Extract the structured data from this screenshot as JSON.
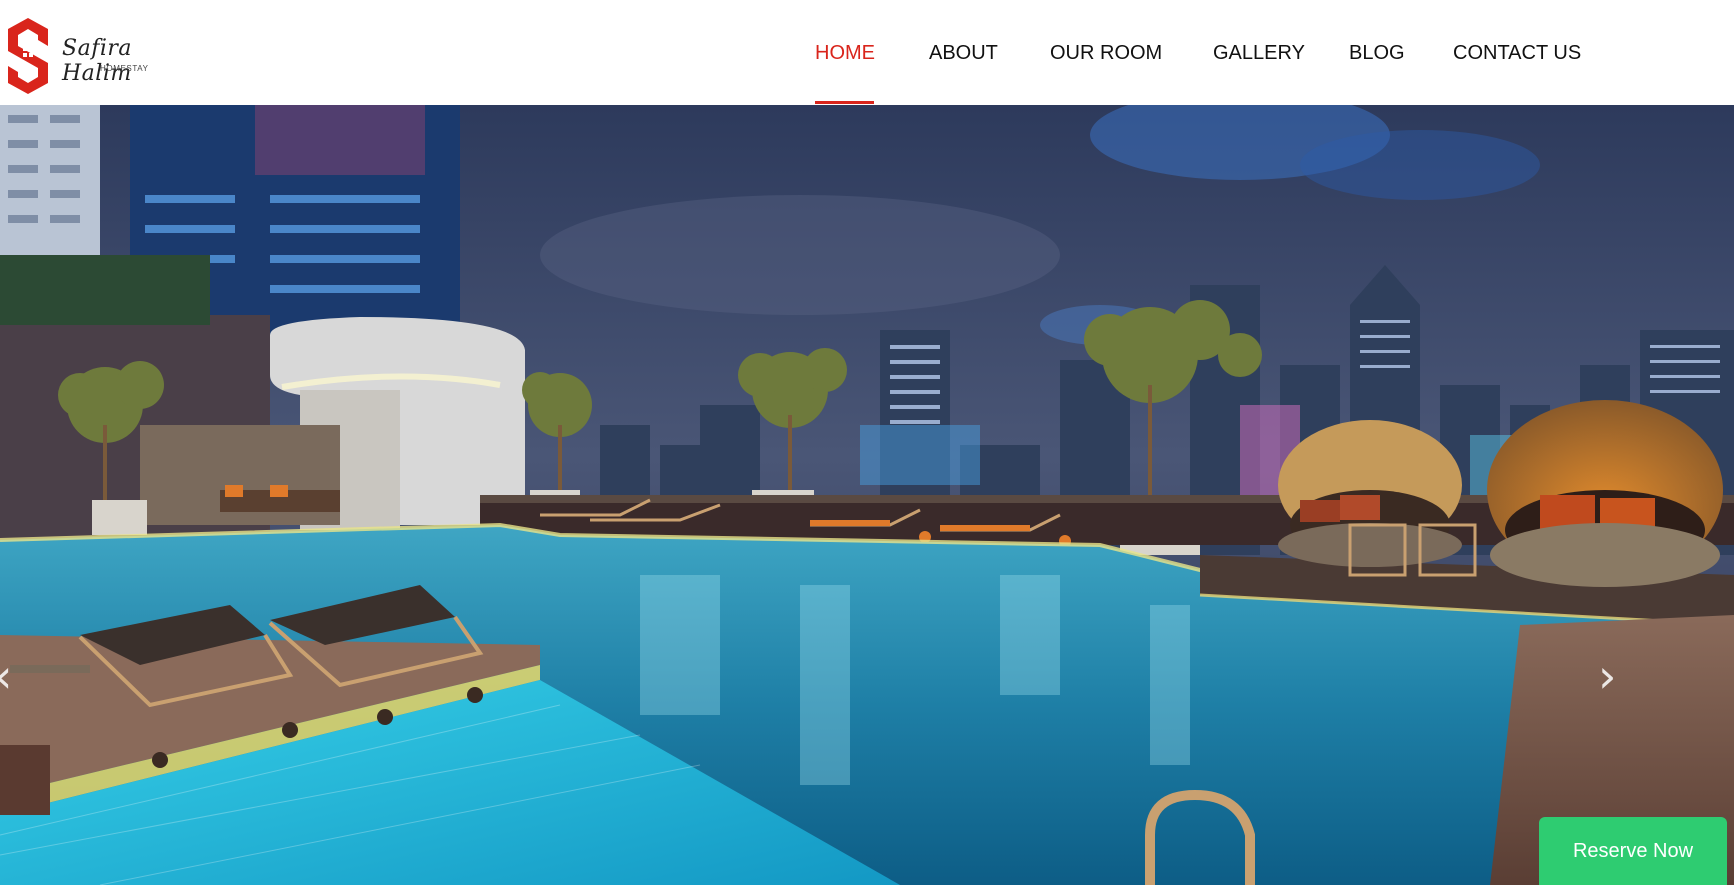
{
  "brand": {
    "name": "Safira Halim",
    "tagline": "HOMESTAY",
    "logo_color": "#d9251c"
  },
  "nav": {
    "items": [
      {
        "label": "HOME",
        "active": true
      },
      {
        "label": "ABOUT",
        "active": false
      },
      {
        "label": "OUR ROOM",
        "active": false
      },
      {
        "label": "GALLERY",
        "active": false
      },
      {
        "label": "BLOG",
        "active": false
      },
      {
        "label": "CONTACT US",
        "active": false
      }
    ],
    "active_color": "#d9251c"
  },
  "hero": {
    "image": "rooftop-pool-night-city-skyline",
    "prev_icon": "chevron-left-icon",
    "next_icon": "chevron-right-icon",
    "prev_glyph": "‹",
    "next_glyph": "›"
  },
  "cta": {
    "reserve_label": "Reserve Now",
    "color": "#2ecc71"
  }
}
